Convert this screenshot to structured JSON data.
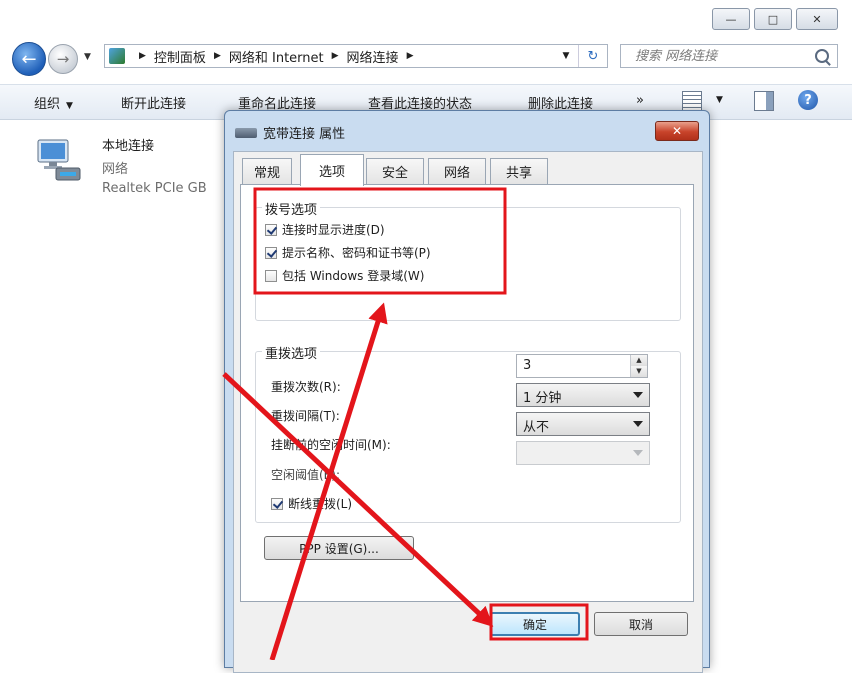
{
  "explorer": {
    "address": [
      "控制面板",
      "网络和 Internet",
      "网络连接"
    ],
    "search_placeholder": "搜索 网络连接",
    "toolbar": {
      "organize": "组织",
      "disconnect": "断开此连接",
      "rename": "重命名此连接",
      "status": "查看此连接的状态",
      "delete": "删除此连接",
      "more": "»"
    },
    "connection": {
      "name": "本地连接",
      "network": "网络",
      "adapter": "Realtek PCIe GB"
    }
  },
  "dialog": {
    "title": "宽带连接 属性",
    "tabs": [
      "常规",
      "选项",
      "安全",
      "网络",
      "共享"
    ],
    "active_tab": "选项",
    "dialing": {
      "title": "拨号选项",
      "options": [
        {
          "label": "连接时显示进度(D)",
          "checked": true
        },
        {
          "label": "提示名称、密码和证书等(P)",
          "checked": true
        },
        {
          "label": "包括 Windows 登录域(W)",
          "checked": false
        }
      ]
    },
    "redial": {
      "title": "重拨选项",
      "attempts_label": "重拨次数(R):",
      "attempts_value": "3",
      "interval_label": "重拨间隔(T):",
      "interval_value": "1 分钟",
      "idle_label": "挂断前的空闲时间(M):",
      "idle_value": "从不",
      "threshold_label": "空闲阈值(E):",
      "threshold_value": "",
      "redial_on_drop_label": "断线重拨(L)",
      "redial_on_drop_checked": true
    },
    "ppp_button": "PPP 设置(G)...",
    "ok_button": "确定",
    "cancel_button": "取消"
  },
  "colors": {
    "annotation": "#e3151b",
    "title_bar": "#c9dcf0",
    "close_button": "#c8432a"
  }
}
